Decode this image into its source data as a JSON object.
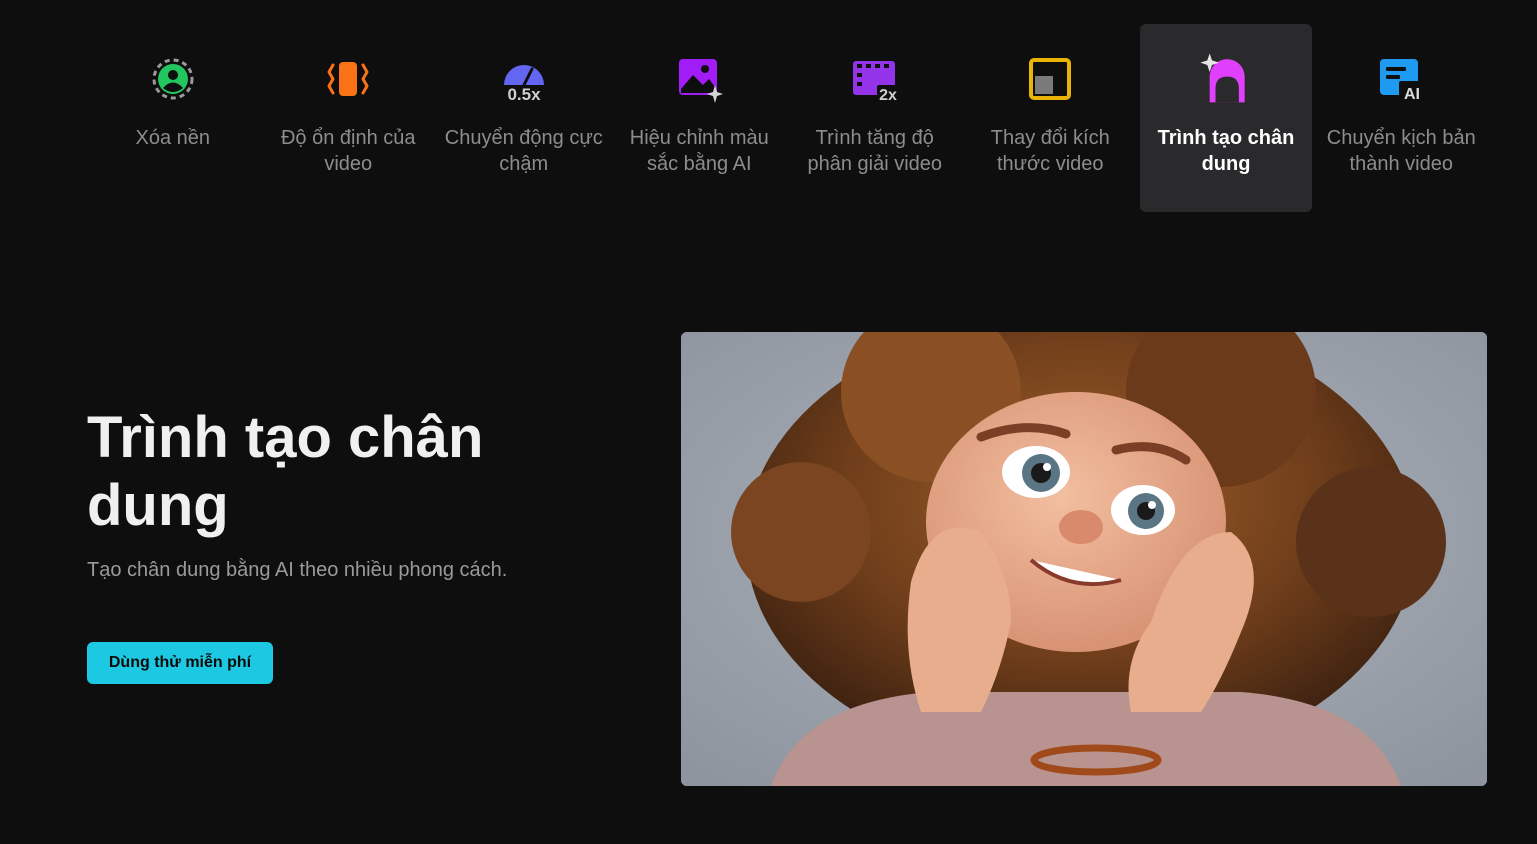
{
  "tabs": [
    {
      "label": "Xóa nền",
      "icon": "remove-background-icon",
      "color": "#22c55e",
      "active": false
    },
    {
      "label": "Độ ổn định của video",
      "icon": "video-stabilization-icon",
      "color": "#f97316",
      "active": false
    },
    {
      "label": "Chuyển động cực chậm",
      "icon": "slow-motion-icon",
      "color": "#6366f1",
      "active": false,
      "badge": "0.5x"
    },
    {
      "label": "Hiệu chỉnh màu sắc bằng AI",
      "icon": "ai-color-correction-icon",
      "color": "#a21cf7",
      "active": false
    },
    {
      "label": "Trình tăng độ phân giải video",
      "icon": "video-upscaler-icon",
      "color": "#9333ea",
      "active": false,
      "badge": "2x"
    },
    {
      "label": "Thay đổi kích thước video",
      "icon": "video-resize-icon",
      "color": "#eab308",
      "active": false
    },
    {
      "label": "Trình tạo chân dung",
      "icon": "portrait-generator-icon",
      "color": "#e040fb",
      "active": true
    },
    {
      "label": "Chuyển kịch bản thành video",
      "icon": "script-to-video-icon",
      "color": "#1e9bf0",
      "active": false,
      "badge": "AI"
    }
  ],
  "hero": {
    "title": "Trình tạo chân dung",
    "description": "Tạo chân dung bằng AI theo nhiều phong cách.",
    "cta_label": "Dùng thử miễn phí",
    "accent_color": "#1dc9e2"
  },
  "image": {
    "subject": "cartoon-portrait-girl-curly-hair"
  }
}
